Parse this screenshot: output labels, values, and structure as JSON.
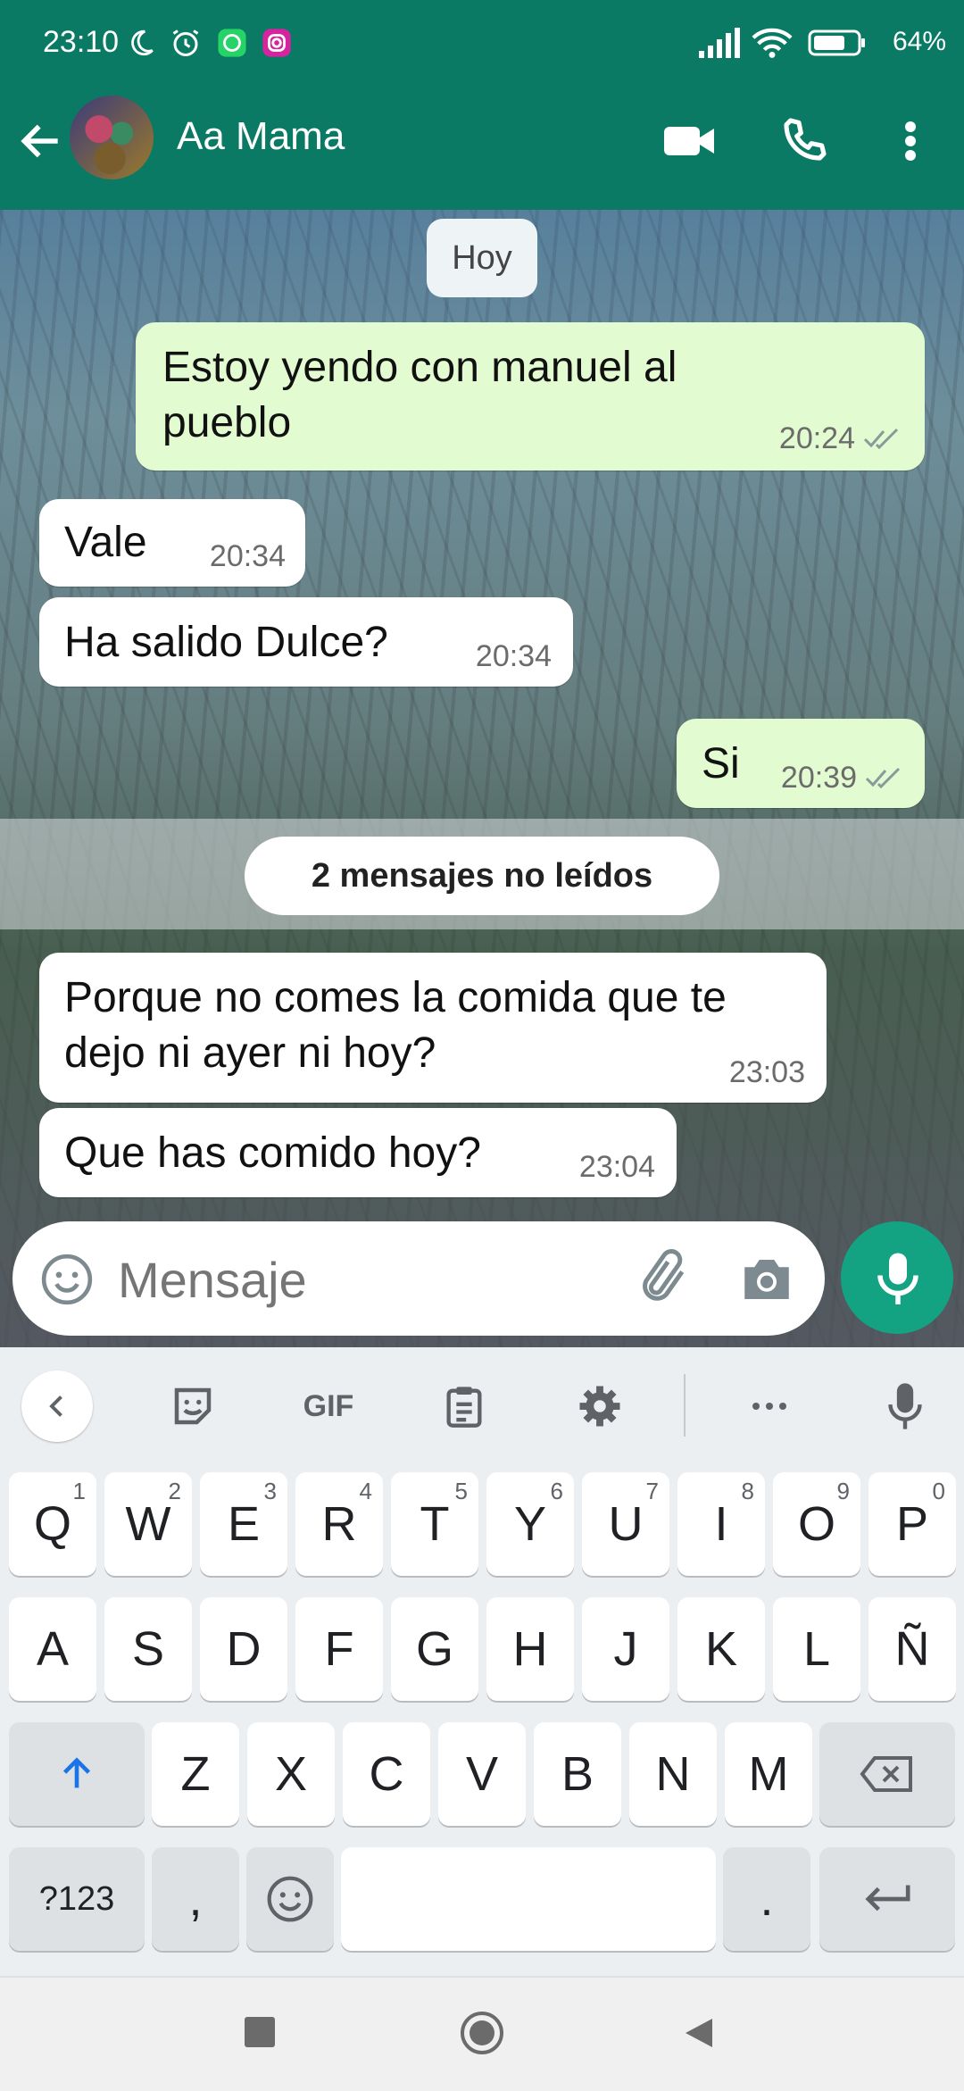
{
  "status_bar": {
    "time": "23:10",
    "battery": "64%"
  },
  "header": {
    "contact_name": "Aa Mama"
  },
  "chat": {
    "date_label": "Hoy",
    "unread_label": "2 mensajes no leídos",
    "messages": [
      {
        "direction": "out",
        "text": "Estoy yendo con manuel al pueblo",
        "time": "20:24"
      },
      {
        "direction": "in",
        "text": "Vale",
        "time": "20:34"
      },
      {
        "direction": "in",
        "text": "Ha salido Dulce?",
        "time": "20:34"
      },
      {
        "direction": "out",
        "text": "Si",
        "time": "20:39"
      },
      {
        "direction": "in",
        "text": "Porque no comes la comida que te dejo ni ayer ni hoy?",
        "time": "23:03"
      },
      {
        "direction": "in",
        "text": "Que has comido hoy?",
        "time": "23:04"
      }
    ]
  },
  "composer": {
    "placeholder": "Mensaje"
  },
  "keyboard": {
    "toolbar": {
      "gif": "GIF"
    },
    "row1": [
      {
        "k": "Q",
        "n": "1"
      },
      {
        "k": "W",
        "n": "2"
      },
      {
        "k": "E",
        "n": "3"
      },
      {
        "k": "R",
        "n": "4"
      },
      {
        "k": "T",
        "n": "5"
      },
      {
        "k": "Y",
        "n": "6"
      },
      {
        "k": "U",
        "n": "7"
      },
      {
        "k": "I",
        "n": "8"
      },
      {
        "k": "O",
        "n": "9"
      },
      {
        "k": "P",
        "n": "0"
      }
    ],
    "row2": [
      "A",
      "S",
      "D",
      "F",
      "G",
      "H",
      "J",
      "K",
      "L",
      "Ñ"
    ],
    "row3": [
      "Z",
      "X",
      "C",
      "V",
      "B",
      "N",
      "M"
    ],
    "symbols": "?123",
    "comma": ",",
    "period": "."
  },
  "colors": {
    "header": "#0b7a64",
    "accent": "#13a383",
    "outgoing_bubble": "#e2fbd0",
    "incoming_bubble": "#ffffff"
  }
}
